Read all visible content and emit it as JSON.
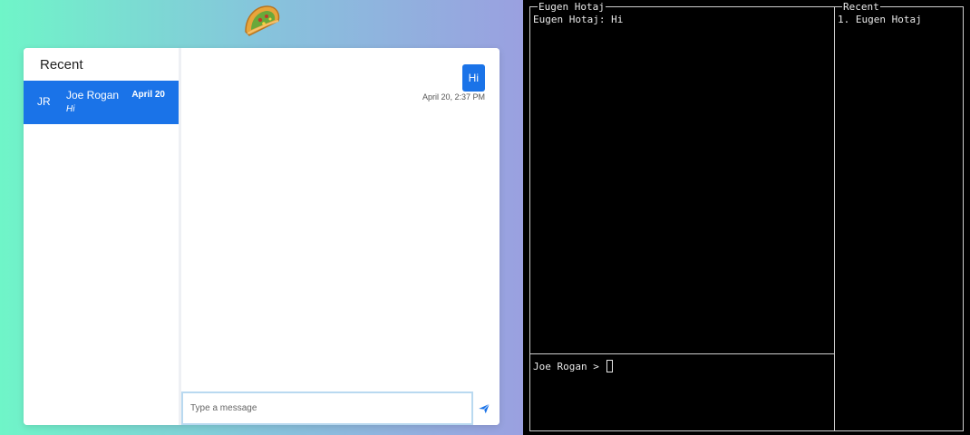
{
  "web": {
    "logo_icon": "taco-icon",
    "sidebar": {
      "title": "Recent",
      "conversations": [
        {
          "initials": "JR",
          "name": "Joe Rogan",
          "date": "April 20",
          "preview": "Hi"
        }
      ]
    },
    "chat": {
      "messages": [
        {
          "text": "Hi",
          "time": "April 20, 2:37 PM"
        }
      ],
      "composer_placeholder": "Type a message",
      "send_icon": "send-icon"
    },
    "colors": {
      "accent": "#1a73e8",
      "gradient_start": "#6ff5c8",
      "gradient_end": "#9aa0e0"
    }
  },
  "terminal": {
    "chat_pane": {
      "title": "Eugen Hotaj",
      "lines": [
        "Eugen Hotaj: Hi"
      ]
    },
    "recent_pane": {
      "title": "Recent",
      "lines": [
        "1. Eugen Hotaj"
      ]
    },
    "input_pane": {
      "prompt": "Joe Rogan > "
    }
  }
}
